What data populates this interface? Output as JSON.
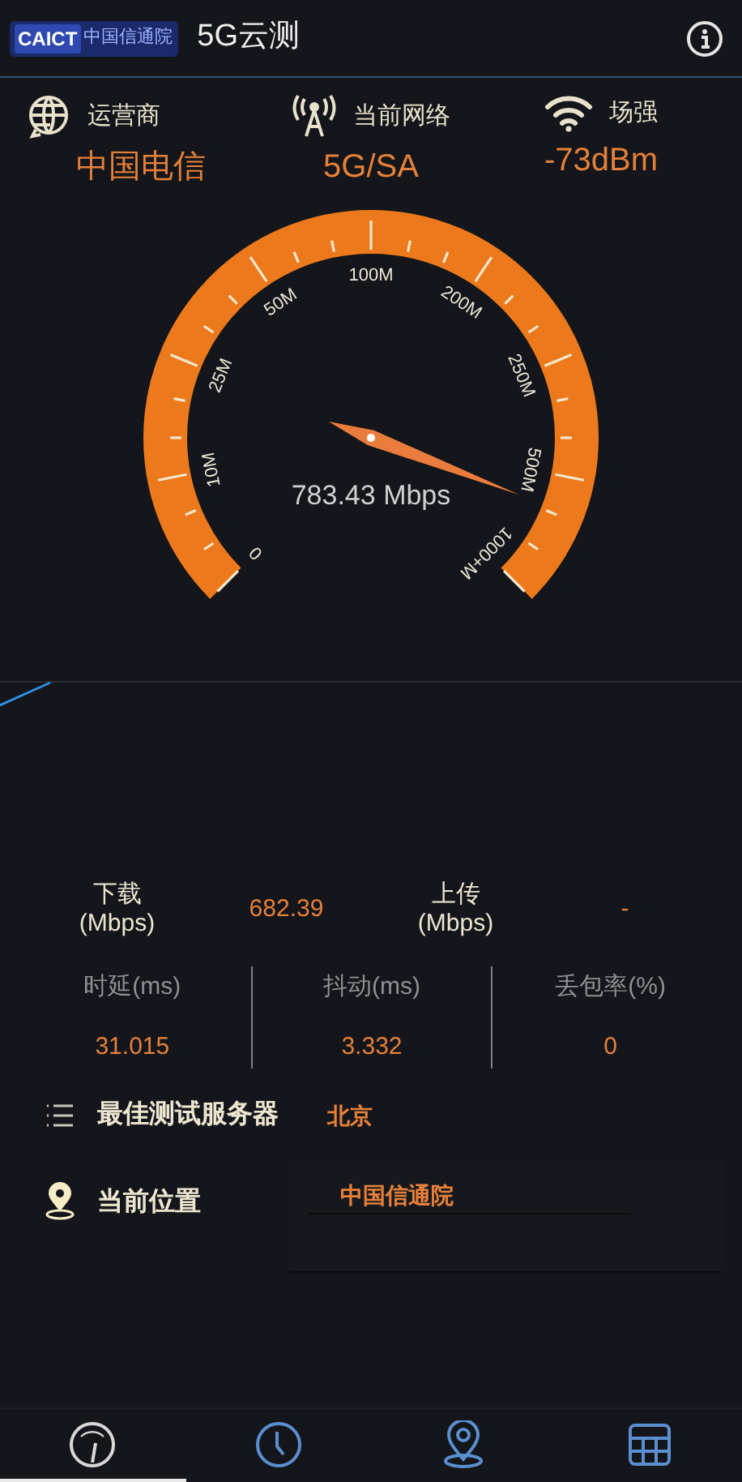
{
  "header": {
    "logo": {
      "latin": "CAICT",
      "chinese": "中国信通院"
    },
    "title": "5G云测"
  },
  "info": [
    {
      "kind": "globe",
      "label": "运营商",
      "value": "中国电信"
    },
    {
      "kind": "antenna",
      "label": "当前网络",
      "value": "5G/SA"
    },
    {
      "kind": "wifi",
      "label": "场强",
      "value": "-73dBm"
    }
  ],
  "gauge": {
    "scale_labels": [
      "0",
      "10M",
      "25M",
      "50M",
      "100M",
      "200M",
      "250M",
      "500M",
      "1000+M"
    ],
    "reading": "783.43 Mbps"
  },
  "transfer": [
    {
      "label": "下载",
      "unit": "(Mbps)",
      "value": "682.39"
    },
    {
      "label": "上传",
      "unit": "(Mbps)",
      "value": "-"
    }
  ],
  "metrics": [
    {
      "label": "时延(ms)",
      "value": "31.015"
    },
    {
      "label": "抖动(ms)",
      "value": "3.332"
    },
    {
      "label": "丢包率(%)",
      "value": "0"
    }
  ],
  "server": {
    "label": "最佳测试服务器",
    "value": "北京"
  },
  "location": {
    "label": "当前位置",
    "value": "中国信通院"
  },
  "nav": [
    {
      "kind": "speed",
      "selected": true
    },
    {
      "kind": "history",
      "selected": false
    },
    {
      "kind": "map",
      "selected": false
    },
    {
      "kind": "table",
      "selected": false
    }
  ]
}
